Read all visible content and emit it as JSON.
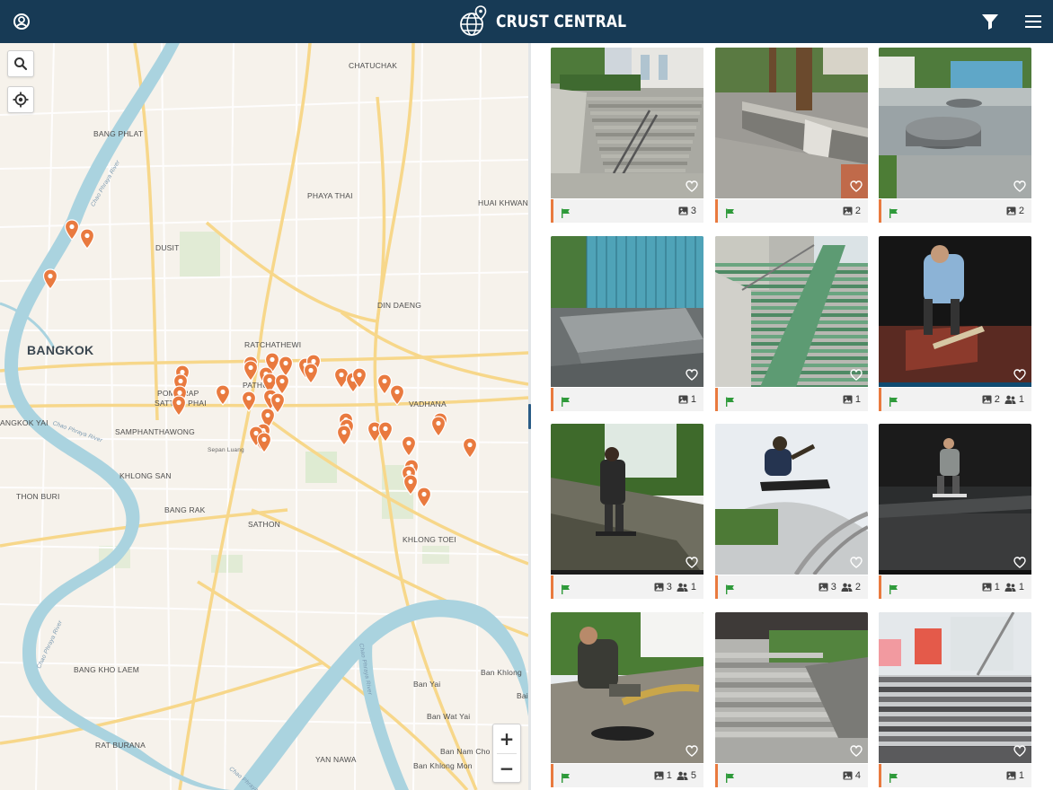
{
  "app": {
    "title": "CRUST CENTRAL"
  },
  "header": {
    "user_icon": "user-circle-icon",
    "filter_icon": "filter-icon",
    "menu_icon": "hamburger-menu-icon",
    "background_color": "#173a55"
  },
  "map": {
    "search_icon": "search-icon",
    "locate_icon": "crosshair-locate-icon",
    "zoom_in": "+",
    "zoom_out": "−",
    "pin_color": "#e97a3f",
    "labels": {
      "chatuchak": "CHATUCHAK",
      "bang_phlat": "BANG PHLAT",
      "phaya_thai": "PHAYA THAI",
      "huai_khwang": "HUAI KHWANG",
      "dusit": "DUSIT",
      "din_daeng": "DIN DAENG",
      "bangkok": "BANGKOK",
      "ratchathewi": "RATCHATHEWI",
      "pathum": "PATHUM",
      "pom_prap": "POM PRAP",
      "sattru_phai": "SATTRU PHAI",
      "vadhana": "VADHANA",
      "bangkok_yai": "ANGKOK YAI",
      "samphanthawong": "SAMPHANTHAWONG",
      "sepan_luang": "Sepan Luang",
      "khlong_san": "KHLONG SAN",
      "thon_buri": "THON BURI",
      "bang_rak": "BANG RAK",
      "sathon": "SATHON",
      "khlong_toei": "KHLONG TOEI",
      "bang_kho_laem": "BANG KHO LAEM",
      "ban_khlong": "Ban Khlong",
      "ban_yai": "Ban Yai",
      "bai": "Bai",
      "ban_wat_yai": "Ban Wat Yai",
      "rat_burana": "RAT BURANA",
      "yan_nawa": "YAN NAWA",
      "ban_nam_cho": "Ban Nam Cho",
      "ban_khlong_mon": "Ban Khlong Mon",
      "chao_phraya_1": "Chao Phraya River",
      "chao_phraya_2": "Chao Phraya River",
      "chao_phraya_3": "Chao Phraya River",
      "chao_phraya_4": "Chao Phraya River",
      "chao_phraya_5": "Chao Phraya River"
    }
  },
  "spots": [
    {
      "scene": "stairs-rail",
      "photos": 3,
      "videos": null
    },
    {
      "scene": "ledge-tree",
      "photos": 2,
      "videos": null
    },
    {
      "scene": "round-plaza",
      "photos": 2,
      "videos": null
    },
    {
      "scene": "blue-fence-steps",
      "photos": 1,
      "videos": null
    },
    {
      "scene": "long-green-stairs",
      "photos": 1,
      "videos": null
    },
    {
      "scene": "night-trick-1",
      "photos": 2,
      "videos": 1
    },
    {
      "scene": "bank-skater",
      "photos": 3,
      "videos": 1
    },
    {
      "scene": "fisheye-air",
      "photos": 3,
      "videos": 2
    },
    {
      "scene": "night-trick-2",
      "photos": 1,
      "videos": 1
    },
    {
      "scene": "crouch-skater",
      "photos": 1,
      "videos": 5
    },
    {
      "scene": "grey-steps",
      "photos": 4,
      "videos": null
    },
    {
      "scene": "central-steps",
      "photos": 1,
      "videos": null
    }
  ],
  "card_icons": {
    "flag": "flag-icon",
    "heart": "heart-icon",
    "photo": "image-icon",
    "video": "people-icon",
    "flag_color": "#2e9a3a",
    "accent_color": "#e97a3f"
  }
}
